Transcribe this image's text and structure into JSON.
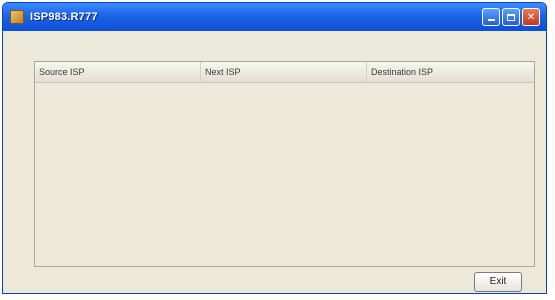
{
  "window": {
    "title": "ISP983.R777"
  },
  "table": {
    "columns": [
      "Source ISP",
      "Next ISP",
      "Destination ISP"
    ],
    "rows": []
  },
  "buttons": {
    "exit_label": "Exit"
  },
  "colors": {
    "titlebar": "#1f63e6",
    "window_bg": "#ece9d8",
    "close_button": "#c2391b"
  }
}
